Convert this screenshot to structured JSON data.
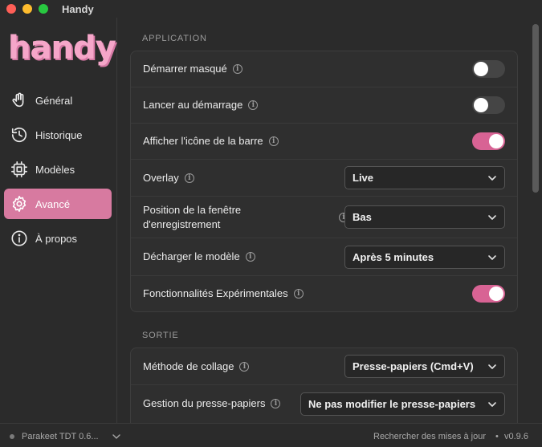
{
  "window": {
    "title": "Handy"
  },
  "sidebar": {
    "logo": "handy",
    "items": [
      {
        "label": "Général",
        "icon": "hand-icon",
        "active": false
      },
      {
        "label": "Historique",
        "icon": "history-icon",
        "active": false
      },
      {
        "label": "Modèles",
        "icon": "chip-icon",
        "active": false
      },
      {
        "label": "Avancé",
        "icon": "gear-icon",
        "active": true
      },
      {
        "label": "À propos",
        "icon": "info-icon",
        "active": false
      }
    ]
  },
  "sections": {
    "application": {
      "title": "APPLICATION",
      "rows": {
        "start_hidden": {
          "label": "Démarrer masqué",
          "checked": false
        },
        "launch_at_startup": {
          "label": "Lancer au démarrage",
          "checked": false
        },
        "show_tray_icon": {
          "label": "Afficher l'icône de la barre",
          "checked": true
        },
        "overlay": {
          "label": "Overlay",
          "value": "Live"
        },
        "recording_window_line1": "Position de la fenêtre",
        "recording_window_line2": "d'enregistrement",
        "recording_window_value": "Bas",
        "unload_model": {
          "label": "Décharger le modèle",
          "value": "Après 5 minutes"
        },
        "experimental": {
          "label": "Fonctionnalités Expérimentales",
          "checked": true
        }
      }
    },
    "output": {
      "title": "SORTIE",
      "rows": {
        "paste_method": {
          "label": "Méthode de collage",
          "value": "Presse-papiers (Cmd+V)"
        },
        "clipboard": {
          "label": "Gestion du presse-papiers",
          "value": "Ne pas modifier le presse-papiers"
        }
      }
    }
  },
  "info_glyph": "i",
  "footer": {
    "model": "Parakeet TDT 0.6...",
    "update": "Rechercher des mises à jour",
    "separator": "•",
    "version": "v0.9.6"
  },
  "colors": {
    "accent": "#d86394",
    "sidebar_active": "#d77aa0",
    "logo": "#f5a6c9"
  }
}
